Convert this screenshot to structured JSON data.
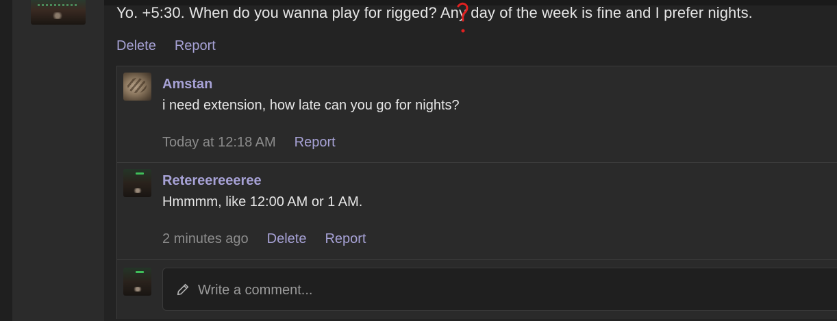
{
  "post": {
    "text": "Yo. +5:30. When do you wanna play for rigged? Any day of the week is fine and I prefer nights.",
    "actions": {
      "delete": "Delete",
      "report": "Report"
    }
  },
  "comments": [
    {
      "author": "Amstan",
      "avatar_icon": "cat-avatar",
      "body": "i need extension, how late can you go for nights?",
      "time": "Today at 12:18 AM",
      "actions": {
        "report": "Report"
      }
    },
    {
      "author": "Retereereeeree",
      "avatar_icon": "user-avatar",
      "body": "Hmmmm, like 12:00 AM or 1 AM.",
      "time": "2 minutes ago",
      "actions": {
        "delete": "Delete",
        "report": "Report"
      }
    }
  ],
  "composer": {
    "placeholder": "Write a comment...",
    "icon": "pencil-icon"
  },
  "colors": {
    "link": "#a7a2d6",
    "text": "#e6e6e6",
    "muted": "#8c8c8c",
    "annotation": "#e02020",
    "background": "#232323"
  }
}
